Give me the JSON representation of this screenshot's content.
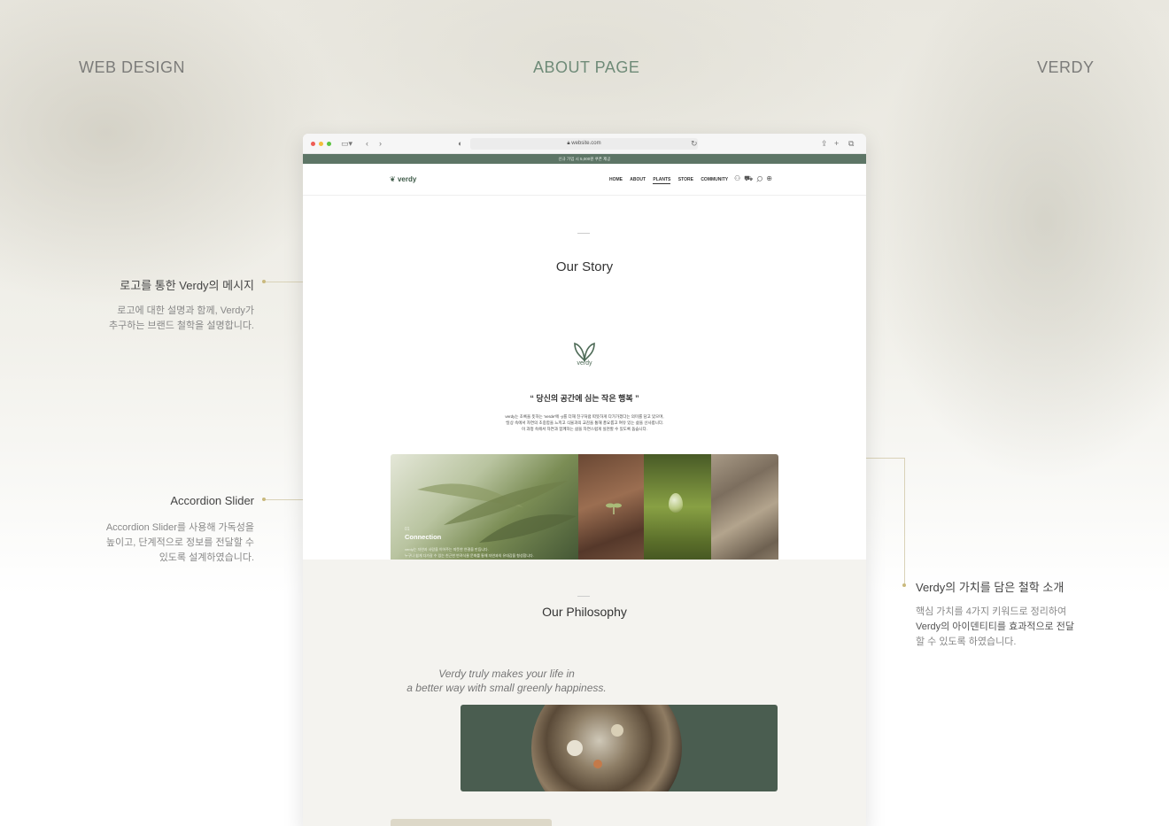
{
  "header": {
    "left": "WEB DESIGN",
    "center": "ABOUT PAGE",
    "right": "VERDY"
  },
  "annotations": {
    "logo": {
      "title": "로고를 통한 Verdy의 메시지",
      "desc_1": "로고에 대한 설명과 함께, Verdy가",
      "desc_2": "추구하는 브랜드 철학을 설명합니다."
    },
    "accordion": {
      "title": "Accordion Slider",
      "desc_1": "Accordion Slider를 사용해 가독성을",
      "desc_2": "높이고, 단계적으로 정보를 전달할 수",
      "desc_3": "있도록 설계하였습니다."
    },
    "philosophy": {
      "title": "Verdy의 가치를 담은 철학 소개",
      "desc_1": "핵심 가치를 4가지 키워드로 정리하여",
      "desc_2": "Verdy의 아이덴티티를 효과적으로 전달",
      "desc_3": "할 수 있도록 하였습니다."
    }
  },
  "browser": {
    "url": "website.com",
    "promo": "신규 가입 시 5,000원 쿠폰 제공",
    "logo": "verdy",
    "menu": [
      "HOME",
      "ABOUT",
      "PLANTS",
      "STORE",
      "COMMUNITY"
    ],
    "active_menu": "PLANTS",
    "icons": [
      "user-icon",
      "cart-icon",
      "search-icon",
      "globe-icon"
    ]
  },
  "story": {
    "title": "Our Story",
    "logo_text": "verdy",
    "quote": "“ 당신의 공간에 심는 작은 행복 ”",
    "para_1": "verdy는 초록을 뜻하는 'verde'에 -y를 더해 친구처럼 따뜻하게 다가가겠다는 의미를 담고 있으며,",
    "para_2": "'일상 속에서 자연의 초중함을 느끼고 식물과의 교감을 통해 풍요롭고 여유 있는 삶을 선사합니다.",
    "para_3": "이 과정 속에서 자연과 함께하는 삶을 자연스럽게 실천할 수 있도록 돕습니다."
  },
  "slider": {
    "number": "01",
    "title": "Connection",
    "desc_1": "verdy는 자연과 사람을 이어주는 따뜻한 연결을 만듭니다.",
    "desc_2": "누구나 쉽게 다가갈 수 있는 친근한 반려식물 문화를 통해 자연과의 유대감을 형성합니다."
  },
  "philosophy": {
    "title": "Our Philosophy",
    "quote_1": "Verdy truly makes your life in",
    "quote_2": "a better way with small greenly happiness."
  },
  "colors": {
    "brand_green": "#5d7566",
    "accent_gold": "#c9b97d",
    "section_bg": "#f4f3ef"
  }
}
